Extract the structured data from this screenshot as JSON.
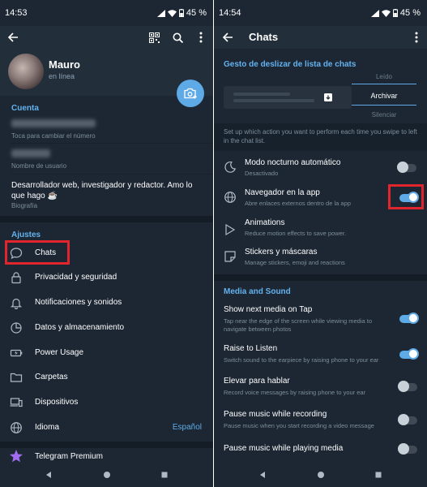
{
  "colors": {
    "background": "#1d2733",
    "header": "#222e3a",
    "accent": "#5eaae6",
    "section_title": "#63b2ee",
    "highlight_box": "#e0252c",
    "muted_text": "#7d8e9d"
  },
  "left": {
    "status_bar": {
      "time": "14:53",
      "battery": "45 %"
    },
    "header": {
      "back_icon": "arrow-left-icon",
      "qr_icon": "qr-code-icon",
      "search_icon": "search-icon",
      "menu_icon": "more-vertical-icon",
      "name": "Mauro",
      "status": "en línea",
      "camera_icon": "camera-plus-icon"
    },
    "account": {
      "title": "Cuenta",
      "phone_hint": "Toca para cambiar el número",
      "username_hint": "Nombre de usuario",
      "bio": "Desarrollador web, investigador y redactor. Amo lo que hago ☕",
      "bio_hint": "Biografía"
    },
    "settings": {
      "title": "Ajustes",
      "items": [
        {
          "label": "Chats",
          "icon": "chat-bubble-icon"
        },
        {
          "label": "Privacidad y seguridad",
          "icon": "lock-icon"
        },
        {
          "label": "Notificaciones y sonidos",
          "icon": "bell-icon"
        },
        {
          "label": "Datos y almacenamiento",
          "icon": "pie-chart-icon"
        },
        {
          "label": "Power Usage",
          "icon": "battery-icon"
        },
        {
          "label": "Carpetas",
          "icon": "folder-icon"
        },
        {
          "label": "Dispositivos",
          "icon": "devices-icon"
        },
        {
          "label": "Idioma",
          "icon": "globe-icon",
          "value": "Español"
        }
      ],
      "premium": {
        "label": "Telegram Premium",
        "icon": "star-icon"
      }
    }
  },
  "right": {
    "status_bar": {
      "time": "14:54",
      "battery": "45 %"
    },
    "top_bar": {
      "title": "Chats",
      "back_icon": "arrow-left-icon",
      "menu_icon": "more-vertical-icon"
    },
    "swipe": {
      "title": "Gesto de deslizar de lista de chats",
      "options": [
        "Leído",
        "Archivar",
        "Silenciar"
      ],
      "selected": "Archivar",
      "hint": "Set up which action you want to perform each time you swipe to left in the chat list."
    },
    "general_items": [
      {
        "title": "Modo nocturno automático",
        "subtitle": "Desactivado",
        "icon": "moon-icon",
        "toggle": "off"
      },
      {
        "title": "Navegador en la app",
        "subtitle": "Abre enlaces externos dentro de la app",
        "icon": "globe-icon",
        "toggle": "on"
      },
      {
        "title": "Animations",
        "subtitle": "Reduce motion effects to save power.",
        "icon": "animation-icon"
      },
      {
        "title": "Stickers y máscaras",
        "subtitle": "Manage stickers, emoji and reactions",
        "icon": "sticker-icon"
      }
    ],
    "media_sound": {
      "title": "Media and Sound",
      "items": [
        {
          "title": "Show next media on Tap",
          "subtitle": "Tap near the edge of the screen while viewing media to navigate between photos",
          "toggle": "on"
        },
        {
          "title": "Raise to Listen",
          "subtitle": "Switch sound to the earpiece by raising phone to your ear",
          "toggle": "on"
        },
        {
          "title": "Elevar para hablar",
          "subtitle": "Record voice messages by raising phone to your ear",
          "toggle": "off"
        },
        {
          "title": "Pause music while recording",
          "subtitle": "Pause music when you start recording a video message",
          "toggle": "off"
        },
        {
          "title": "Pause music while playing media",
          "subtitle": "",
          "toggle": "off"
        }
      ]
    }
  }
}
